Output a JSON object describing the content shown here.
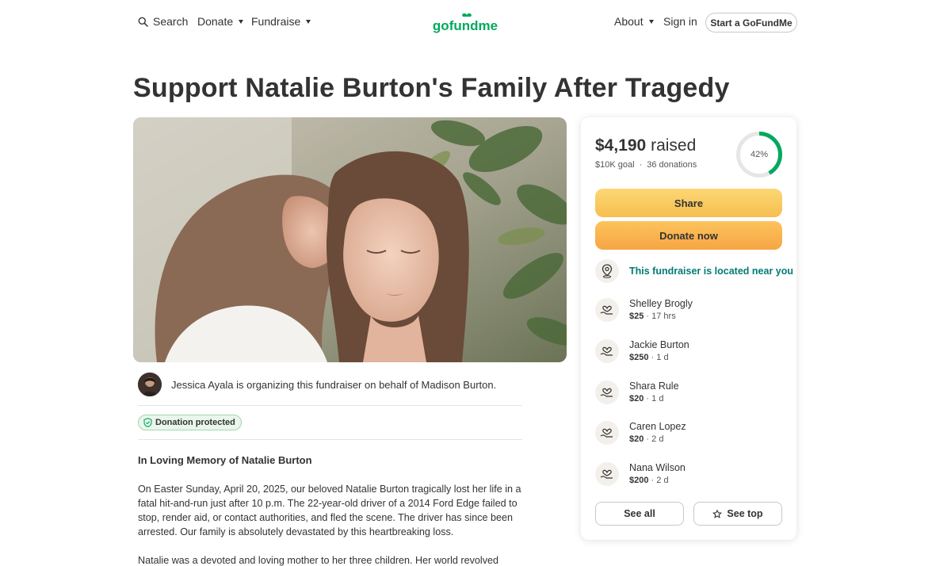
{
  "nav": {
    "search_label": "Search",
    "donate_label": "Donate",
    "fundraise_label": "Fundraise",
    "logo_text": "gofundme",
    "about_label": "About",
    "signin_label": "Sign in",
    "start_label": "Start a GoFundMe"
  },
  "campaign": {
    "title": "Support Natalie Burton's Family After Tragedy",
    "organizer_text": "Jessica Ayala is organizing this fundraiser on behalf of Madison Burton.",
    "badge_label": "Donation protected",
    "story_heading": "In Loving Memory of Natalie Burton",
    "story_paragraphs": [
      "On Easter Sunday, April 20, 2025, our beloved Natalie Burton tragically lost her life in a fatal hit-and-run just after 10 p.m. The 22-year-old driver of a 2014 Ford Edge failed to stop, render aid, or contact authorities, and fled the scene. The driver has since been arrested. Our family is absolutely devastated by this heartbreaking loss.",
      "Natalie was a devoted and loving mother to her three children. Her world revolved around"
    ]
  },
  "donation_card": {
    "amount_raised": "$4,190",
    "raised_word": "raised",
    "goal": "$10K goal",
    "separator": "·",
    "donations_count": "36 donations",
    "progress_percent": 42,
    "progress_label": "42%",
    "share_label": "Share",
    "donate_now_label": "Donate now",
    "located_label": "This fundraiser is located near you",
    "donors": [
      {
        "name": "Shelley Brogly",
        "amount": "$25",
        "time": "17 hrs"
      },
      {
        "name": "Jackie Burton",
        "amount": "$250",
        "time": "1 d"
      },
      {
        "name": "Shara Rule",
        "amount": "$20",
        "time": "1 d"
      },
      {
        "name": "Caren Lopez",
        "amount": "$20",
        "time": "2 d"
      },
      {
        "name": "Nana Wilson",
        "amount": "$200",
        "time": "2 d"
      }
    ],
    "see_all_label": "See all",
    "see_top_label": "See top"
  },
  "colors": {
    "brand_green": "#02a95c",
    "located_teal": "#017b76",
    "share_yellow": "#f9c85e",
    "donate_orange": "#f9b04d"
  }
}
